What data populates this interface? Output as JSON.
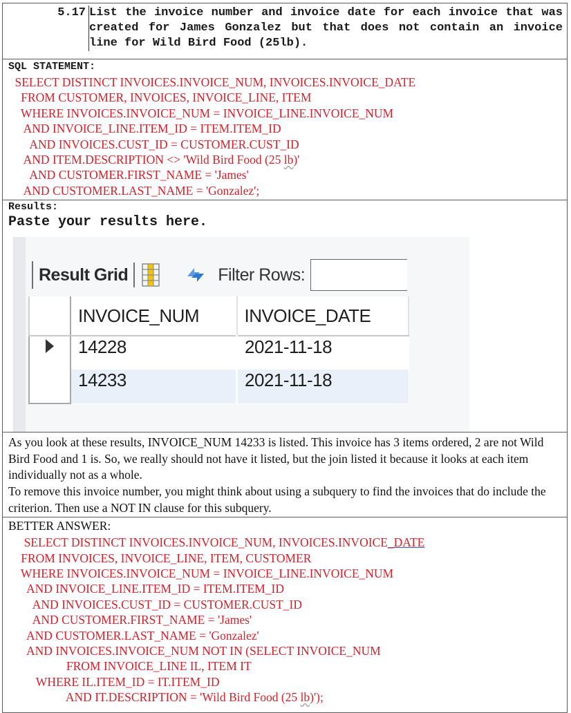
{
  "question": {
    "number": "5.17",
    "text": "List the invoice number and invoice date for each invoice that was created for James Gonzalez but that does not contain an invoice line for Wild Bird Food (25lb)."
  },
  "sql_section": {
    "label": "SQL STATEMENT:",
    "lines": [
      {
        "indent": "    ",
        "text": "SELECT DISTINCT INVOICES.INVOICE_NUM, INVOICES.INVOICE_DATE"
      },
      {
        "indent": "      ",
        "text": "FROM CUSTOMER, INVOICES, INVOICE_LINE, ITEM"
      },
      {
        "indent": "      ",
        "text": "WHERE INVOICES.INVOICE_NUM = INVOICE_LINE.INVOICE_NUM"
      },
      {
        "indent": "       ",
        "text": "AND INVOICE_LINE.ITEM_ID = ITEM.ITEM_ID"
      },
      {
        "indent": "         ",
        "text": "AND INVOICES.CUST_ID = CUSTOMER.CUST_ID"
      },
      {
        "indent": "       ",
        "text": "AND ITEM.DESCRIPTION <> 'Wild Bird Food (25 ",
        "squiggle": "lb",
        "after": ")'"
      },
      {
        "indent": "         ",
        "text": "AND CUSTOMER.FIRST_NAME = 'James'"
      },
      {
        "indent": "       ",
        "text": "AND CUSTOMER.LAST_NAME = 'Gonzalez';"
      }
    ]
  },
  "results": {
    "label": "Results:",
    "paste_prompt": "Paste your results here.",
    "grid": {
      "toolbar_title": "Result Grid",
      "grid_icon": "column-grid-icon",
      "refresh_icon": "refresh-icon",
      "filter_label": "Filter Rows:",
      "filter_value": "",
      "columns": [
        "INVOICE_NUM",
        "INVOICE_DATE"
      ],
      "rows": [
        {
          "invoice_num": "14228",
          "invoice_date": "2021-11-18",
          "selected": true
        },
        {
          "invoice_num": "14233",
          "invoice_date": "2021-11-18",
          "selected": false
        }
      ]
    }
  },
  "explanation": {
    "paragraphs": [
      "As you look at these results, INVOICE_NUM 14233 is listed.  This invoice has 3 items ordered, 2 are not Wild Bird Food and 1 is.  So, we really should not have it listed, but the join listed it because it looks at each item individually not as a whole.",
      "To remove this invoice number, you might think about using a subquery to find the invoices that do include the criterion.  Then use a NOT IN clause for this subquery."
    ]
  },
  "better_answer": {
    "label": "BETTER ANSWER:",
    "lines": [
      {
        "indent": "       ",
        "text": "SELECT DISTINCT INVOICES.INVOICE_NUM, INVOICES.INVOICE",
        "underlined": "_DATE"
      },
      {
        "indent": "      ",
        "text": "FROM INVOICES, INVOICE_LINE, ITEM, CUSTOMER"
      },
      {
        "indent": "      ",
        "text": "WHERE INVOICES.INVOICE_NUM = INVOICE_LINE.INVOICE_NUM"
      },
      {
        "indent": "        ",
        "text": "AND INVOICE_LINE.ITEM_ID = ITEM.ITEM_ID"
      },
      {
        "indent": "          ",
        "text": "AND INVOICES.CUST_ID = CUSTOMER.CUST_ID"
      },
      {
        "indent": "          ",
        "text": "AND CUSTOMER.FIRST_NAME = 'James'"
      },
      {
        "indent": "        ",
        "text": "AND CUSTOMER.LAST_NAME = 'Gonzalez'"
      },
      {
        "indent": "        ",
        "text": "AND INVOICES.INVOICE_NUM NOT IN (SELECT INVOICE_NUM"
      },
      {
        "indent": "                     ",
        "text": "FROM INVOICE_LINE IL, ITEM IT"
      },
      {
        "indent": "           ",
        "text": "WHERE IL.ITEM_ID = IT.ITEM_ID"
      },
      {
        "indent": "                     ",
        "text": "AND IT.DESCRIPTION = 'Wild Bird Food (25 ",
        "squiggle": "lb",
        "after": ")');"
      }
    ]
  },
  "colors": {
    "sql_text": "#d6202a",
    "body_text": "#111111",
    "row_highlight": "#e9f0fa",
    "refresh_blue": "#3b86d8",
    "grid_icon_yellow": "#f2c500"
  }
}
